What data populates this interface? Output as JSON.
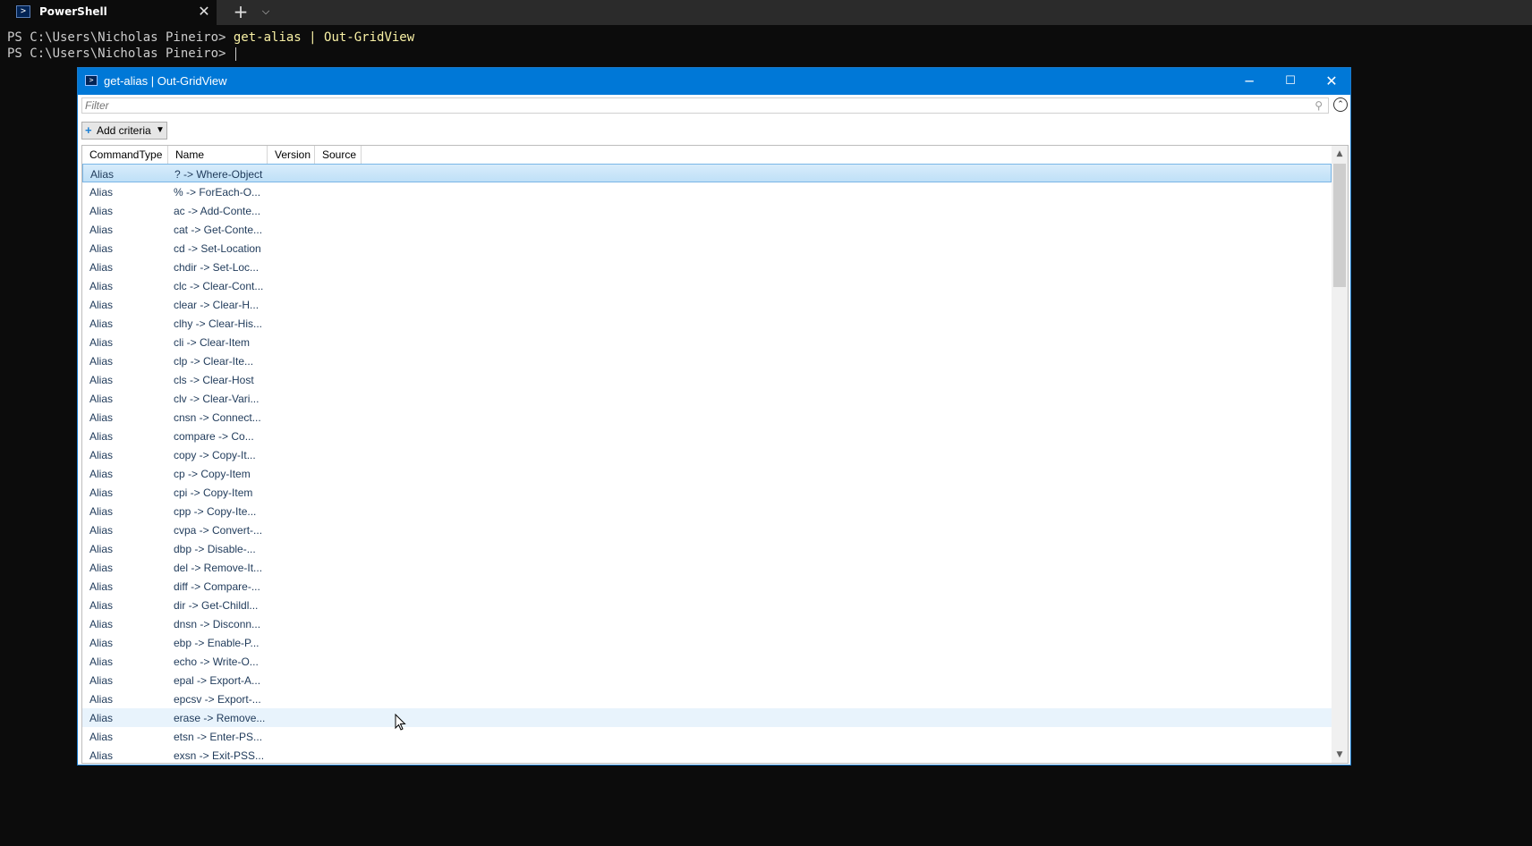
{
  "terminal": {
    "tab_title": "PowerShell",
    "tab_icon": "powershell-icon",
    "close_glyph": "✕",
    "new_tab_glyph": "+",
    "dropdown_glyph": "⌄",
    "prompt": "PS C:\\Users\\Nicholas Pineiro> ",
    "command": "get-alias | Out-GridView",
    "second_prompt": "PS C:\\Users\\Nicholas Pineiro> "
  },
  "window": {
    "title": "get-alias | Out-GridView",
    "minimize_glyph": "─",
    "maximize_glyph": "☐",
    "close_glyph": "✕"
  },
  "filter": {
    "placeholder": "Filter"
  },
  "add_criteria": {
    "label": "Add criteria"
  },
  "columns": [
    "CommandType",
    "Name",
    "Version",
    "Source"
  ],
  "rows": [
    {
      "type": "Alias",
      "name": "? -> Where-Object"
    },
    {
      "type": "Alias",
      "name": "% -> ForEach-O..."
    },
    {
      "type": "Alias",
      "name": "ac -> Add-Conte..."
    },
    {
      "type": "Alias",
      "name": "cat -> Get-Conte..."
    },
    {
      "type": "Alias",
      "name": "cd -> Set-Location"
    },
    {
      "type": "Alias",
      "name": "chdir -> Set-Loc..."
    },
    {
      "type": "Alias",
      "name": "clc -> Clear-Cont..."
    },
    {
      "type": "Alias",
      "name": "clear -> Clear-H..."
    },
    {
      "type": "Alias",
      "name": "clhy -> Clear-His..."
    },
    {
      "type": "Alias",
      "name": "cli -> Clear-Item"
    },
    {
      "type": "Alias",
      "name": "clp -> Clear-Ite..."
    },
    {
      "type": "Alias",
      "name": "cls -> Clear-Host"
    },
    {
      "type": "Alias",
      "name": "clv -> Clear-Vari..."
    },
    {
      "type": "Alias",
      "name": "cnsn -> Connect..."
    },
    {
      "type": "Alias",
      "name": "compare -> Co..."
    },
    {
      "type": "Alias",
      "name": "copy -> Copy-It..."
    },
    {
      "type": "Alias",
      "name": "cp -> Copy-Item"
    },
    {
      "type": "Alias",
      "name": "cpi -> Copy-Item"
    },
    {
      "type": "Alias",
      "name": "cpp -> Copy-Ite..."
    },
    {
      "type": "Alias",
      "name": "cvpa -> Convert-..."
    },
    {
      "type": "Alias",
      "name": "dbp -> Disable-..."
    },
    {
      "type": "Alias",
      "name": "del -> Remove-It..."
    },
    {
      "type": "Alias",
      "name": "diff -> Compare-..."
    },
    {
      "type": "Alias",
      "name": "dir -> Get-Childl..."
    },
    {
      "type": "Alias",
      "name": "dnsn -> Disconn..."
    },
    {
      "type": "Alias",
      "name": "ebp -> Enable-P..."
    },
    {
      "type": "Alias",
      "name": "echo -> Write-O..."
    },
    {
      "type": "Alias",
      "name": "epal -> Export-A..."
    },
    {
      "type": "Alias",
      "name": "epcsv -> Export-..."
    },
    {
      "type": "Alias",
      "name": "erase -> Remove..."
    },
    {
      "type": "Alias",
      "name": "etsn -> Enter-PS..."
    },
    {
      "type": "Alias",
      "name": "exsn -> Exit-PSS..."
    }
  ],
  "selected_row": 0,
  "hovered_row": 29
}
